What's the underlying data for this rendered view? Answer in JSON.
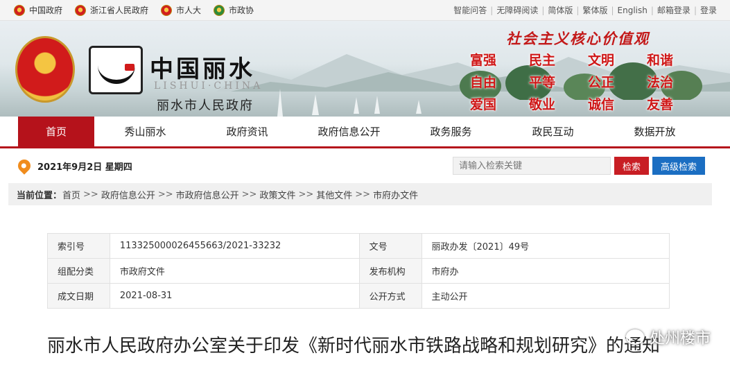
{
  "topbar": {
    "links": [
      {
        "label": "中国政府"
      },
      {
        "label": "浙江省人民政府"
      },
      {
        "label": "市人大"
      },
      {
        "label": "市政协"
      }
    ],
    "utils": [
      "智能问答",
      "无障碍阅读",
      "简体版",
      "繁体版",
      "English",
      "邮箱登录",
      "登录"
    ]
  },
  "banner": {
    "logo_cn": "中国丽水",
    "logo_en": "LISHUI·CHINA",
    "logo_sub": "丽水市人民政府",
    "values_title": "社会主义核心价值观",
    "values": [
      "富强",
      "民主",
      "文明",
      "和谐",
      "自由",
      "平等",
      "公正",
      "法治",
      "爱国",
      "敬业",
      "诚信",
      "友善"
    ]
  },
  "nav": {
    "items": [
      "首页",
      "秀山丽水",
      "政府资讯",
      "政府信息公开",
      "政务服务",
      "政民互动",
      "数据开放"
    ],
    "active_index": 0
  },
  "datebar": {
    "date": "2021年9月2日 星期四",
    "search_placeholder": "请输入检索关键",
    "search_label": "检索",
    "advanced_label": "高级检索"
  },
  "breadcrumb": {
    "prefix": "当前位置：",
    "items": [
      "首页",
      "政府信息公开",
      "市政府信息公开",
      "政策文件",
      "其他文件",
      "市府办文件"
    ],
    "separator": ">>"
  },
  "info": {
    "rows": [
      {
        "k1": "索引号",
        "v1": "113325000026455663/2021-33232",
        "k2": "文号",
        "v2": "丽政办发〔2021〕49号"
      },
      {
        "k1": "组配分类",
        "v1": "市政府文件",
        "k2": "发布机构",
        "v2": "市府办"
      },
      {
        "k1": "成文日期",
        "v1": "2021-08-31",
        "k2": "公开方式",
        "v2": "主动公开"
      }
    ]
  },
  "document": {
    "title": "丽水市人民政府办公室关于印发《新时代丽水市铁路战略和规划研究》的通知"
  },
  "watermark": {
    "text": "处州楼市"
  },
  "colors": {
    "brand_red": "#b5121b",
    "search_red": "#c81e24",
    "search_blue": "#1b6ec2"
  }
}
